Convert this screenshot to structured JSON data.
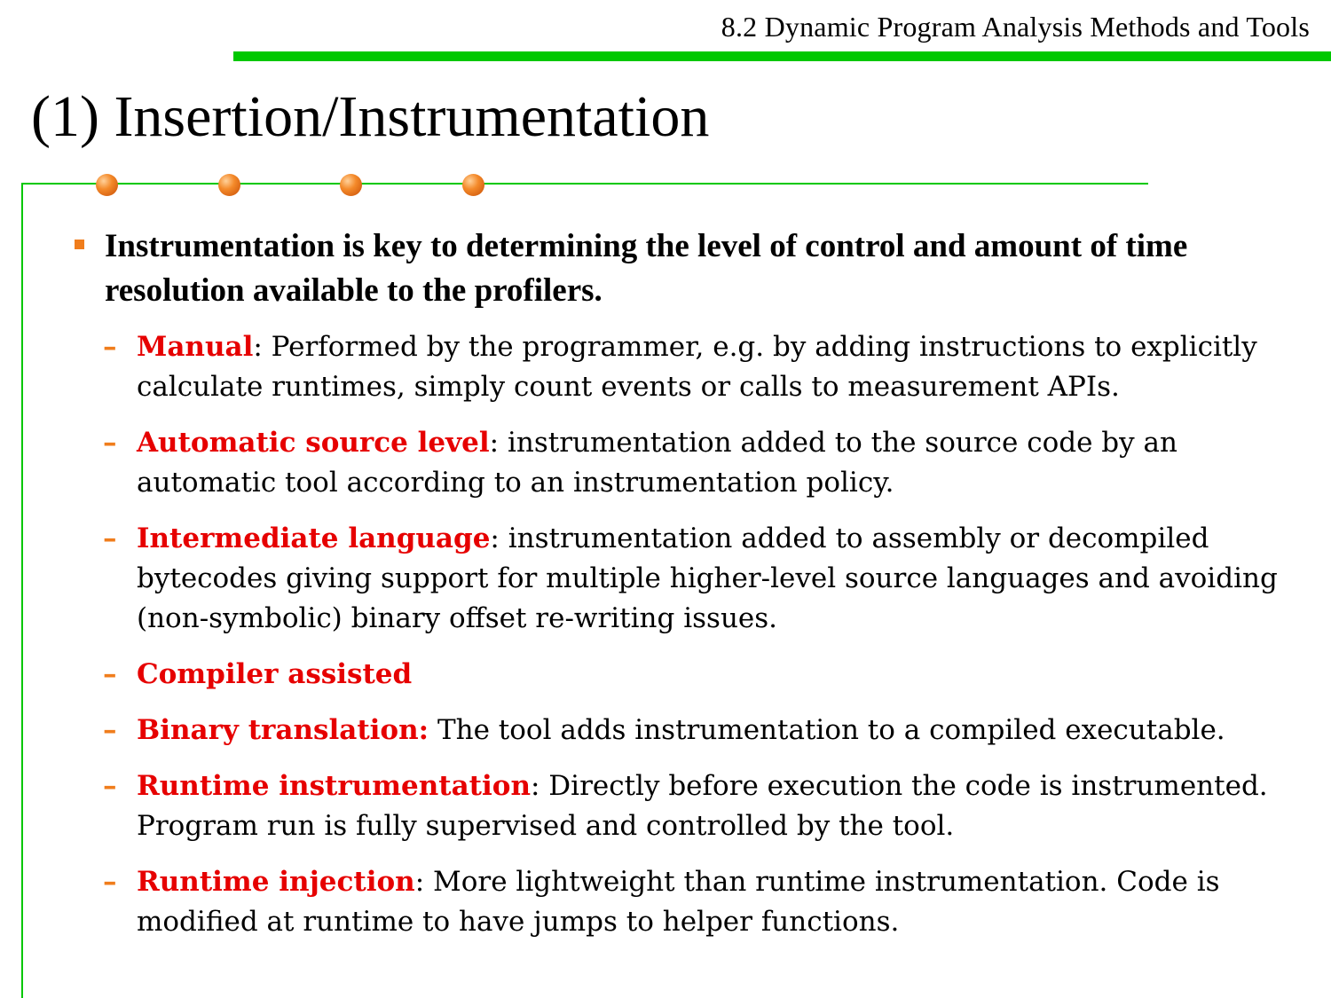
{
  "header": {
    "section": "8.2 Dynamic Program Analysis Methods and Tools"
  },
  "title": "(1) Insertion/Instrumentation",
  "colors": {
    "accent_green": "#00c800",
    "bullet_orange": "#f07d1c",
    "term_red": "#e60000"
  },
  "main_bullet": "Instrumentation is key to determining the level of control and amount of time resolution available to the profilers.",
  "items": [
    {
      "term": "Manual",
      "text": ": Performed by the programmer, e.g. by adding instructions to explicitly calculate runtimes, simply count events or calls to measurement APIs."
    },
    {
      "term": "Automatic source level",
      "text": ": instrumentation added to the source code by an automatic tool according to an instrumentation policy."
    },
    {
      "term": "Intermediate language",
      "text": ": instrumentation added to assembly or decompiled bytecodes giving support for multiple higher-level source languages and avoiding (non-symbolic) binary offset re-writing issues."
    },
    {
      "term": "Compiler assisted",
      "text": ""
    },
    {
      "term": "Binary translation:",
      "text": " The tool adds instrumentation to a compiled executable."
    },
    {
      "term": "Runtime instrumentation",
      "text": ": Directly before execution the code is instrumented. Program run is fully supervised and controlled by the tool."
    },
    {
      "term": "Runtime injection",
      "text": ": More lightweight than runtime instrumentation. Code is modified at runtime to have jumps to helper functions."
    }
  ]
}
